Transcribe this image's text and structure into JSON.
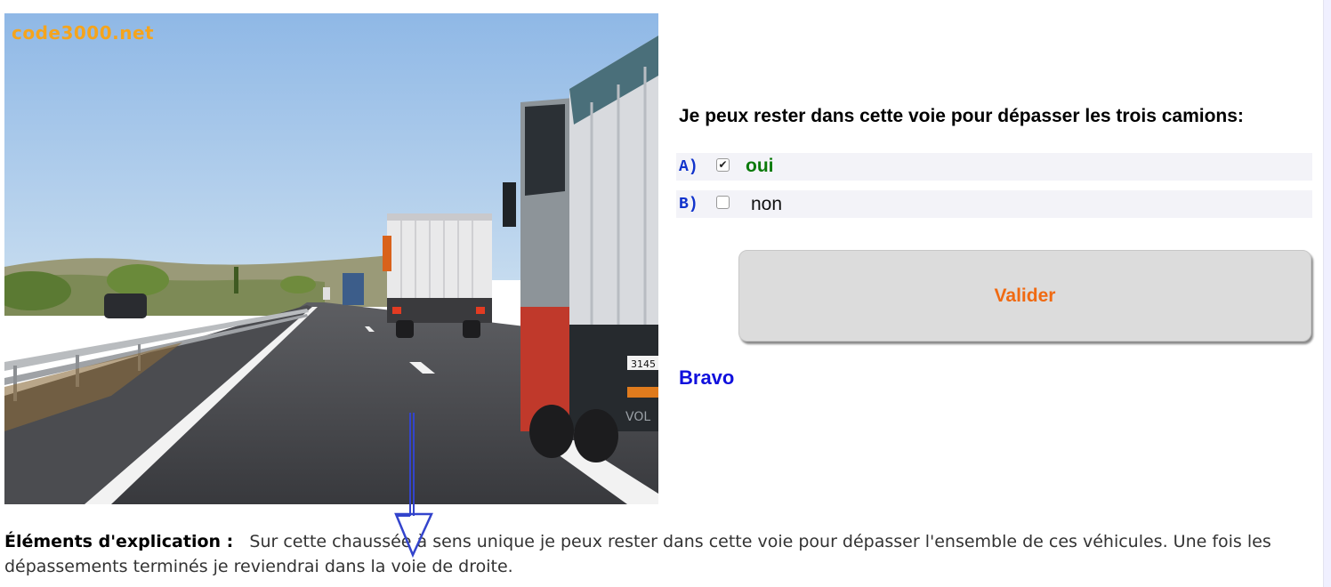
{
  "photo": {
    "watermark": "code3000.net",
    "plate_text": "3145",
    "brand_text": "VOL"
  },
  "question": {
    "text": "Je peux rester dans cette voie pour dépasser les trois camions:"
  },
  "answers": [
    {
      "letter": "A)",
      "label": "oui",
      "checked": true,
      "status": "correct"
    },
    {
      "letter": "B)",
      "label": "non",
      "checked": false,
      "status": "none"
    }
  ],
  "validate_button": {
    "label": "Valider"
  },
  "feedback": {
    "text": "Bravo"
  },
  "explanation": {
    "label": "Éléments d'explication :",
    "text": "Sur cette chaussée à sens unique je peux rester dans cette voie pour dépasser l'ensemble de ces véhicules. Une fois les dépassements terminés je reviendrai dans la voie de droite."
  },
  "colors": {
    "answer_letter": "#1133cc",
    "correct_answer": "#0b7a0b",
    "validate_text": "#f06a12",
    "feedback": "#1010dd",
    "watermark": "#f5a41c"
  },
  "icons": {
    "annotation": "down-arrow-icon",
    "checkbox_checked": "check-icon"
  }
}
